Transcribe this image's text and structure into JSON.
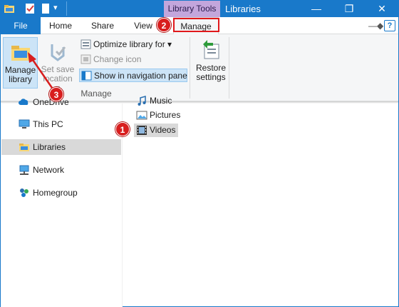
{
  "titlebar": {
    "context_tab": "Library Tools",
    "title": "Libraries",
    "minimize": "—",
    "maximize": "❐",
    "close": "✕"
  },
  "tabs": {
    "file": "File",
    "home": "Home",
    "share": "Share",
    "view": "View",
    "manage": "Manage",
    "pin": "—◆",
    "expand": "∨",
    "help": "?"
  },
  "ribbon": {
    "manage_library": [
      "Manage",
      "library"
    ],
    "set_save_location": [
      "Set save",
      "location ▾"
    ],
    "optimize_library": "Optimize library for ▾",
    "change_icon": "Change icon",
    "show_in_nav_pane": "Show in navigation pane",
    "restore_settings": [
      "Restore",
      "settings"
    ],
    "group_manage": "Manage"
  },
  "nav_pane": {
    "items": [
      {
        "label": "OneDrive",
        "icon": "onedrive-icon"
      },
      {
        "label": "This PC",
        "icon": "computer-icon"
      },
      {
        "label": "Libraries",
        "icon": "libraries-icon",
        "selected": true
      },
      {
        "label": "Network",
        "icon": "network-icon"
      },
      {
        "label": "Homegroup",
        "icon": "homegroup-icon"
      }
    ]
  },
  "content": {
    "items": [
      {
        "label": "Music",
        "icon": "music-library-icon"
      },
      {
        "label": "Pictures",
        "icon": "pictures-library-icon"
      },
      {
        "label": "Videos",
        "icon": "videos-library-icon",
        "selected": true
      }
    ]
  },
  "annotations": {
    "step1": "1",
    "step2": "2",
    "step3": "3",
    "color": "#d81e1e"
  },
  "colors": {
    "accent": "#1979ca",
    "context_tab": "#c3a6dc",
    "selection": "#cce4f7"
  }
}
